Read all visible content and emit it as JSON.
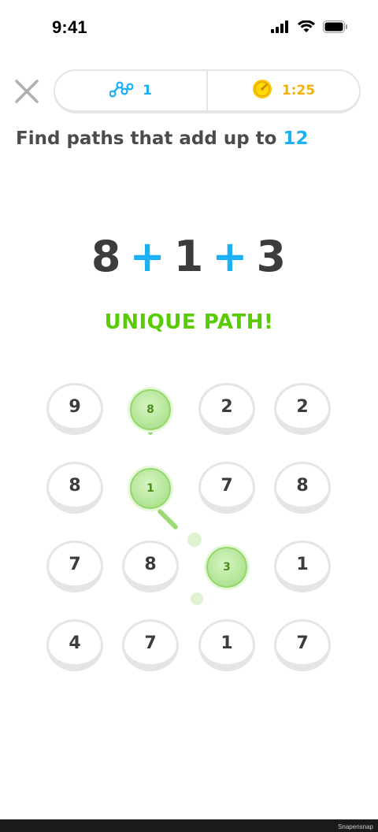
{
  "status_bar": {
    "time": "9:41"
  },
  "header": {
    "paths_found": "1",
    "timer": "1:25"
  },
  "prompt": {
    "text": "Find paths that add up to ",
    "target": "12"
  },
  "equation": {
    "terms": [
      "8",
      "1",
      "3"
    ],
    "operator": "+"
  },
  "feedback": "UNIQUE PATH!",
  "grid": {
    "rows": [
      [
        "9",
        "8",
        "2",
        "2"
      ],
      [
        "8",
        "1",
        "7",
        "8"
      ],
      [
        "7",
        "8",
        "3",
        "1"
      ],
      [
        "4",
        "7",
        "1",
        "7"
      ]
    ],
    "selected_cells": [
      "r0c1",
      "r1c1",
      "r2c2"
    ]
  },
  "watermark": "Snapensnap",
  "colors": {
    "accent_blue": "#1cb0f6",
    "success_green": "#58cc02",
    "timer_gold": "#f2b10c"
  }
}
